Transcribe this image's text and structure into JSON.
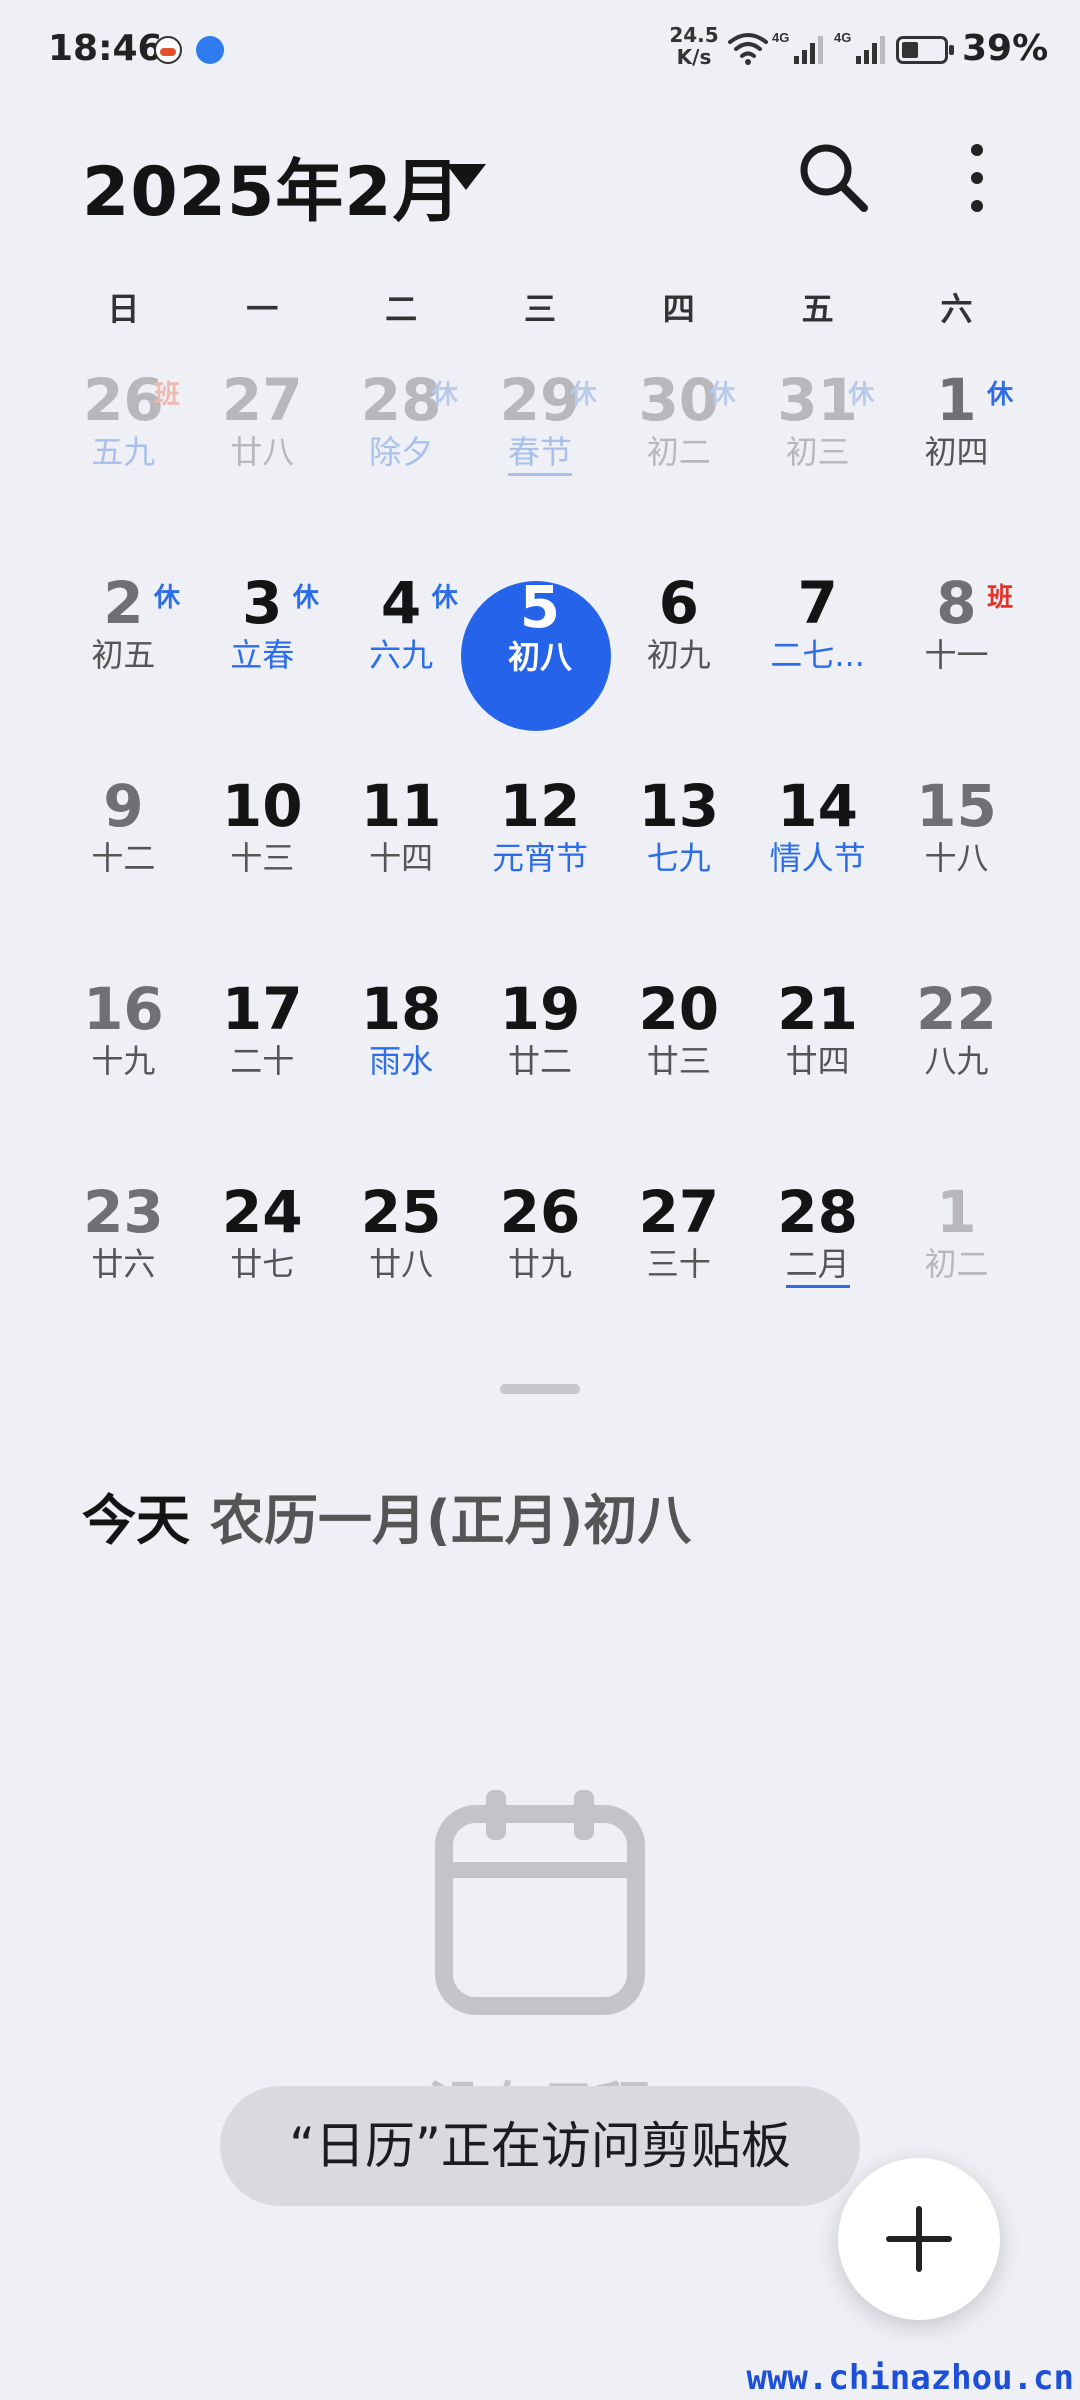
{
  "status_bar": {
    "time": "18:46",
    "net_speed_value": "24.5",
    "net_speed_unit": "K/s",
    "signal_label_1": "4G",
    "signal_label_2": "4G",
    "battery_percent": "39%",
    "battery_level": 0.39
  },
  "header": {
    "title": "2025年2月"
  },
  "weekdays": [
    "日",
    "一",
    "二",
    "三",
    "四",
    "五",
    "六"
  ],
  "calendar": {
    "weeks": [
      [
        {
          "day": "26",
          "lunar": "五九",
          "badge": "班",
          "badge_type": "work",
          "other": true,
          "lunar_style": "holiday"
        },
        {
          "day": "27",
          "lunar": "廿八",
          "badge": "",
          "other": true
        },
        {
          "day": "28",
          "lunar": "除夕",
          "badge": "休",
          "other": true,
          "lunar_style": "holiday"
        },
        {
          "day": "29",
          "lunar": "春节",
          "badge": "休",
          "other": true,
          "lunar_style": "holiday",
          "underline": true
        },
        {
          "day": "30",
          "lunar": "初二",
          "badge": "休",
          "other": true
        },
        {
          "day": "31",
          "lunar": "初三",
          "badge": "休",
          "other": true
        },
        {
          "day": "1",
          "lunar": "初四",
          "badge": "休"
        }
      ],
      [
        {
          "day": "2",
          "lunar": "初五",
          "badge": "休"
        },
        {
          "day": "3",
          "lunar": "立春",
          "badge": "休",
          "lunar_style": "holiday"
        },
        {
          "day": "4",
          "lunar": "六九",
          "badge": "休",
          "lunar_style": "holiday"
        },
        {
          "day": "5",
          "lunar": "初八",
          "badge": "",
          "today": true
        },
        {
          "day": "6",
          "lunar": "初九",
          "badge": ""
        },
        {
          "day": "7",
          "lunar": "二七...",
          "badge": "",
          "lunar_style": "holiday"
        },
        {
          "day": "8",
          "lunar": "十一",
          "badge": "班",
          "badge_type": "work"
        }
      ],
      [
        {
          "day": "9",
          "lunar": "十二",
          "badge": ""
        },
        {
          "day": "10",
          "lunar": "十三",
          "badge": ""
        },
        {
          "day": "11",
          "lunar": "十四",
          "badge": ""
        },
        {
          "day": "12",
          "lunar": "元宵节",
          "badge": "",
          "lunar_style": "holiday"
        },
        {
          "day": "13",
          "lunar": "七九",
          "badge": "",
          "lunar_style": "holiday"
        },
        {
          "day": "14",
          "lunar": "情人节",
          "badge": "",
          "lunar_style": "holiday"
        },
        {
          "day": "15",
          "lunar": "十八",
          "badge": ""
        }
      ],
      [
        {
          "day": "16",
          "lunar": "十九",
          "badge": ""
        },
        {
          "day": "17",
          "lunar": "二十",
          "badge": ""
        },
        {
          "day": "18",
          "lunar": "雨水",
          "badge": "",
          "lunar_style": "holiday"
        },
        {
          "day": "19",
          "lunar": "廿二",
          "badge": ""
        },
        {
          "day": "20",
          "lunar": "廿三",
          "badge": ""
        },
        {
          "day": "21",
          "lunar": "廿四",
          "badge": ""
        },
        {
          "day": "22",
          "lunar": "八九",
          "badge": "",
          "lunar_style": "holiday"
        }
      ],
      [
        {
          "day": "23",
          "lunar": "廿六",
          "badge": ""
        },
        {
          "day": "24",
          "lunar": "廿七",
          "badge": ""
        },
        {
          "day": "25",
          "lunar": "廿八",
          "badge": ""
        },
        {
          "day": "26",
          "lunar": "廿九",
          "badge": ""
        },
        {
          "day": "27",
          "lunar": "三十",
          "badge": ""
        },
        {
          "day": "28",
          "lunar": "二月",
          "badge": "",
          "underline": true
        },
        {
          "day": "1",
          "lunar": "初二",
          "badge": "",
          "other": true
        }
      ]
    ]
  },
  "today_info": {
    "label": "今天",
    "lunar_date": "农历一月(正月)初八"
  },
  "empty_state": {
    "text": "没有日程"
  },
  "toast": {
    "text": "“日历”正在访问剪贴板"
  },
  "watermark": "www.chinazhou.cn",
  "colors": {
    "accent": "#2563eb",
    "holiday_blue": "#2d6ee8",
    "work_red": "#e5332a",
    "background": "#eef0f5"
  },
  "icons": {
    "search": "search-icon",
    "more": "more-vertical-icon",
    "add": "plus-icon",
    "empty": "calendar-icon"
  }
}
